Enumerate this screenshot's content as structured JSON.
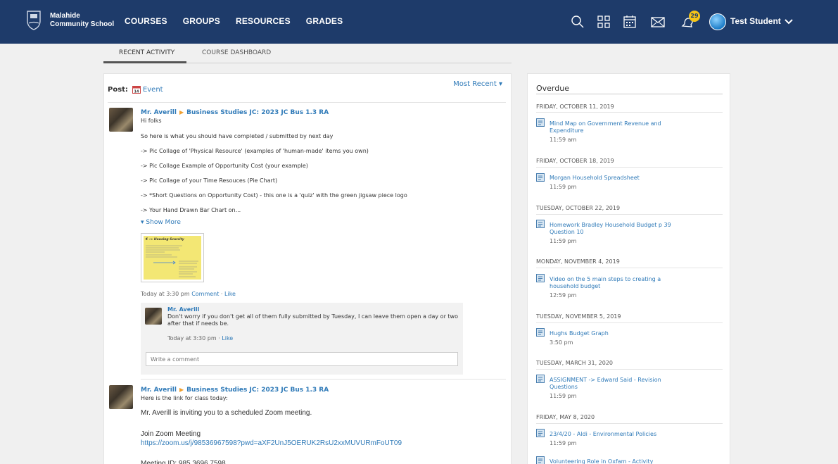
{
  "nav": {
    "school_line1": "Malahide",
    "school_line2": "Community School",
    "links": [
      "COURSES",
      "GROUPS",
      "RESOURCES",
      "GRADES"
    ],
    "notification_count": "29",
    "user_name": "Test Student",
    "icons": [
      "search-icon",
      "apps-grid-icon",
      "calendar-icon",
      "mail-icon",
      "notifications-icon"
    ],
    "colors": {
      "nav_bg": "#1e3b6a",
      "link": "#2f7ab8",
      "badge": "#f5c518"
    }
  },
  "tabs": [
    "RECENT ACTIVITY",
    "COURSE DASHBOARD"
  ],
  "feed": {
    "post_label": "Post:",
    "event_label": "Event",
    "sort_label": "Most Recent",
    "post1": {
      "author": "Mr. Averill",
      "course": "Business Studies JC: 2023 JC Bus 1.3 RA",
      "lines": [
        "Hi folks",
        "So here is what you should have completed / submitted by next day",
        "-> Pic Collage of 'Physical Resource' (examples of 'human-made' items you own)",
        "-> Pic Collage Example of Opportunity Cost (your example)",
        "-> Pic Collage of your Time Resouces (Pie Chart)",
        "-> *Short Questions on Opportunity Cost) - this one is a 'quiz' with the green jigsaw piece logo",
        "-> Your Hand Drawn Bar Chart on..."
      ],
      "show_more": "Show More",
      "attachment_title": "€ -> Housing Scarcity",
      "meta_time": "Today at 3:30 pm",
      "comment_label": "Comment",
      "like_label": "Like",
      "comment": {
        "author": "Mr. Averill",
        "text": "Don't worry if you don't get all of them fully submitted by Tuesday, I can leave them open a day or two after that if needs be.",
        "time": "Today at 3:30 pm",
        "like_label": "Like"
      },
      "write_placeholder": "Write a comment"
    },
    "post2": {
      "author": "Mr. Averill",
      "course": "Business Studies JC: 2023 JC Bus 1.3 RA",
      "intro": "Here is the link for class today:",
      "invite": "Mr. Averill is inviting you to a scheduled Zoom meeting.",
      "join": "Join Zoom Meeting",
      "link": "https://zoom.us/j/98536967598?pwd=aXF2UnJ5OERUK2RsU2xxMUVURmFoUT09",
      "meeting_id": "Meeting ID: 985 3696 7598"
    }
  },
  "overdue": {
    "title": "Overdue",
    "groups": [
      {
        "date": "FRIDAY, OCTOBER 11, 2019",
        "item": "Mind Map on Government Revenue and Expenditure",
        "time": "11:59 am"
      },
      {
        "date": "FRIDAY, OCTOBER 18, 2019",
        "item": "Morgan Household Spreadsheet",
        "time": "11:59 pm"
      },
      {
        "date": "TUESDAY, OCTOBER 22, 2019",
        "item": "Homework Bradley Household Budget p 39 Question 10",
        "time": "11:59 pm"
      },
      {
        "date": "MONDAY, NOVEMBER 4, 2019",
        "item": "Video on the 5 main steps to creating a household budget",
        "time": "12:59 pm"
      },
      {
        "date": "TUESDAY, NOVEMBER 5, 2019",
        "item": "Hughs Budget Graph",
        "time": "3:50 pm"
      },
      {
        "date": "TUESDAY, MARCH 31, 2020",
        "item": "ASSIGNMENT -> Edward Said - Revision Questions",
        "time": "11:59 pm"
      },
      {
        "date": "FRIDAY, MAY 8, 2020",
        "item": "23/4/20 - Aldi - Environmental Policies",
        "time": "11:59 pm"
      },
      {
        "date": "",
        "item": "Volunteering Role in Oxfam - Activity",
        "time": ""
      }
    ]
  }
}
